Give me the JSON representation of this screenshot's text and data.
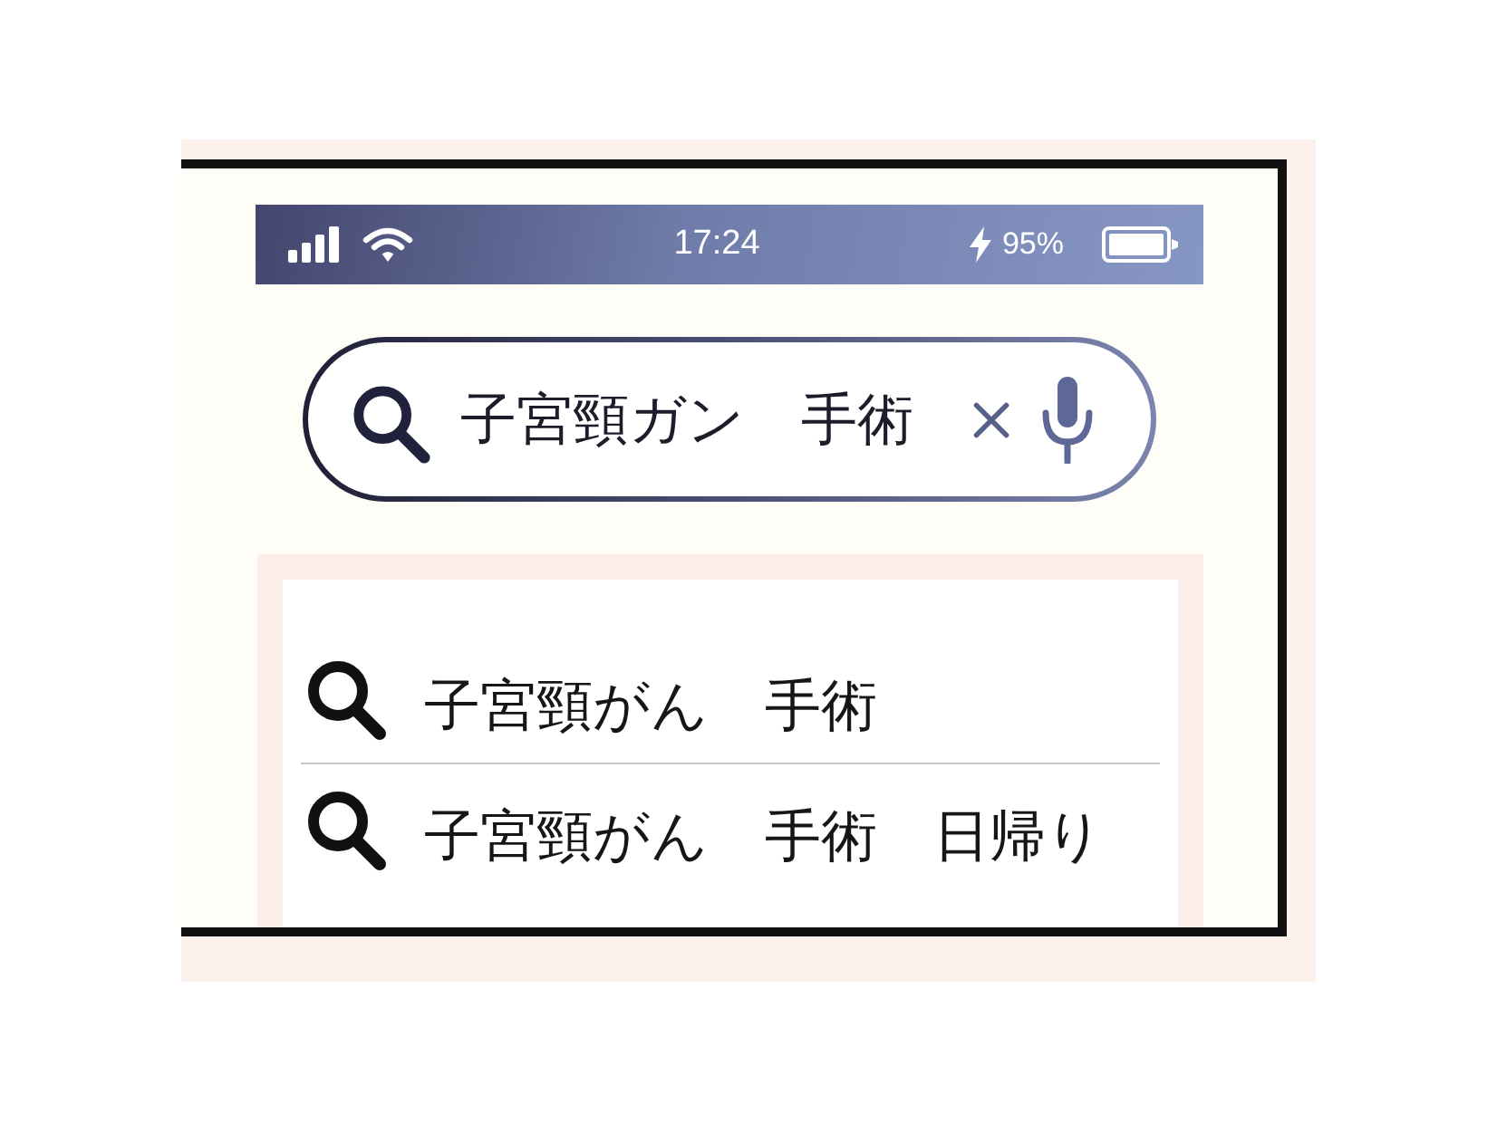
{
  "status_bar": {
    "time": "17:24",
    "charging": true,
    "battery": "95%"
  },
  "search": {
    "value": "子宮頸ガン　手術"
  },
  "suggestions": [
    {
      "text": "子宮頸がん　手術"
    },
    {
      "text": "子宮頸がん　手術　日帰り"
    }
  ]
}
